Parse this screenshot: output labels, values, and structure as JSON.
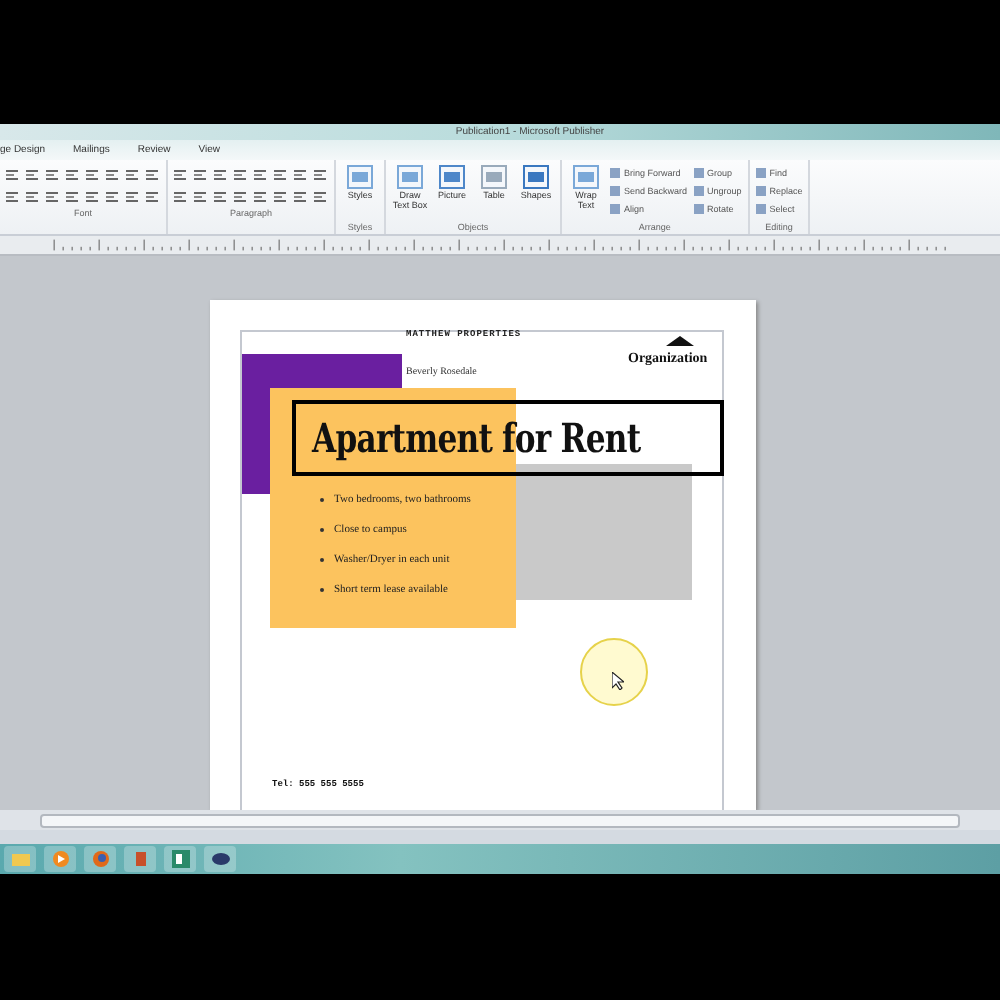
{
  "window": {
    "title": "Publication1 - Microsoft Publisher"
  },
  "tabs": [
    {
      "label": "ge Design"
    },
    {
      "label": "Mailings"
    },
    {
      "label": "Review"
    },
    {
      "label": "View"
    }
  ],
  "ribbon": [
    {
      "label": "Font",
      "kind": "formatting"
    },
    {
      "label": "Paragraph",
      "kind": "formatting"
    },
    {
      "label": "Styles",
      "kind": "buttons",
      "buttons": [
        {
          "label": "Styles",
          "kind": "large"
        }
      ]
    },
    {
      "label": "Objects",
      "kind": "buttons",
      "buttons": [
        {
          "label": "Draw Text Box",
          "kind": "large"
        },
        {
          "label": "Picture",
          "kind": "large"
        },
        {
          "label": "Table",
          "kind": "large"
        },
        {
          "label": "Shapes",
          "kind": "large"
        }
      ]
    },
    {
      "label": "Arrange",
      "kind": "buttons",
      "buttons": [
        {
          "label": "Wrap Text",
          "kind": "large"
        },
        {
          "label": "Bring Forward",
          "kind": "small"
        },
        {
          "label": "Send Backward",
          "kind": "small"
        },
        {
          "label": "Align",
          "kind": "small"
        },
        {
          "label": "Group",
          "kind": "small"
        },
        {
          "label": "Ungroup",
          "kind": "small"
        },
        {
          "label": "Rotate",
          "kind": "small"
        }
      ]
    },
    {
      "label": "Editing",
      "kind": "buttons",
      "buttons": [
        {
          "label": "Find",
          "kind": "small"
        },
        {
          "label": "Replace",
          "kind": "small"
        },
        {
          "label": "Select",
          "kind": "small"
        }
      ]
    }
  ],
  "document": {
    "company": "MATTHEW PROPERTIES",
    "organization": "Organization",
    "contact": "Beverly Rosedale",
    "headline": "Apartment for Rent",
    "bullets": [
      "Two bedrooms, two bathrooms",
      "Close to campus",
      "Washer/Dryer in each unit",
      "Short term lease available"
    ],
    "phone": "Tel: 555 555 5555"
  }
}
